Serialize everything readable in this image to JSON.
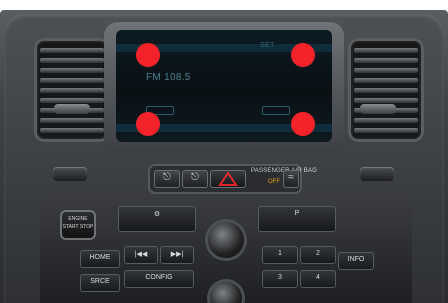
{
  "screen": {
    "station": "FM 108.5",
    "top_label": "SET",
    "touch_markers": [
      "top-left",
      "top-right",
      "bottom-left",
      "bottom-right"
    ],
    "marker_color": "#f4232a"
  },
  "controls": {
    "air_bag_label": "PASSENGER AIR BAG",
    "air_bag_status": "OFF",
    "engine_button": [
      "ENGINE",
      "START STOP"
    ],
    "home": "HOME",
    "config": "CONFIG",
    "info": "INFO",
    "source": "SRCE",
    "seek_back": "|◀◀",
    "seek_forward": "▶▶|",
    "presets": [
      "1",
      "2",
      "3",
      "4"
    ]
  }
}
